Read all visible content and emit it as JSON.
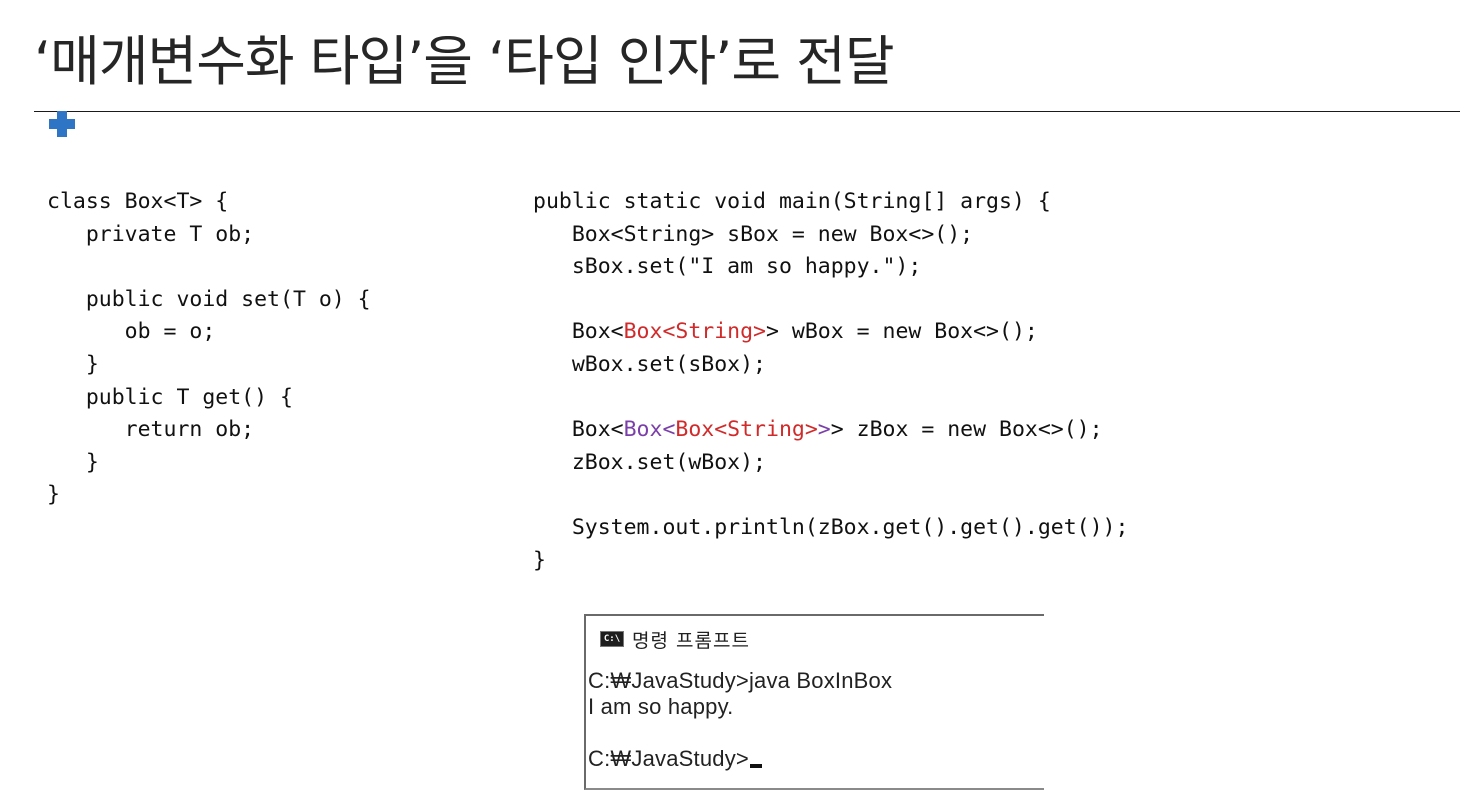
{
  "slide": {
    "title": "‘매개변수화 타입’을 ‘타입 인자’로 전달"
  },
  "code_left": {
    "lines": [
      [
        {
          "t": "class Box<T> {"
        }
      ],
      [
        {
          "t": "   private T ob;"
        }
      ],
      [
        {
          "t": ""
        }
      ],
      [
        {
          "t": "   public void set(T o) {"
        }
      ],
      [
        {
          "t": "      ob = o;"
        }
      ],
      [
        {
          "t": "   }"
        }
      ],
      [
        {
          "t": "   public T get() {"
        }
      ],
      [
        {
          "t": "      return ob;"
        }
      ],
      [
        {
          "t": "   }"
        }
      ],
      [
        {
          "t": "}"
        }
      ]
    ]
  },
  "code_right": {
    "lines": [
      [
        {
          "t": "public static void main(String[] args) {"
        }
      ],
      [
        {
          "t": "   Box<String> sBox = new Box<>();"
        }
      ],
      [
        {
          "t": "   sBox.set(\"I am so happy.\");"
        }
      ],
      [
        {
          "t": ""
        }
      ],
      [
        {
          "t": "   Box<"
        },
        {
          "t": "Box<String>",
          "c": "red"
        },
        {
          "t": "> wBox = new Box<>();"
        }
      ],
      [
        {
          "t": "   wBox.set(sBox);"
        }
      ],
      [
        {
          "t": ""
        }
      ],
      [
        {
          "t": "   Box<"
        },
        {
          "t": "Box<",
          "c": "purple"
        },
        {
          "t": "Box<String>",
          "c": "red"
        },
        {
          "t": ">",
          "c": "purple"
        },
        {
          "t": "> zBox = new Box<>();"
        }
      ],
      [
        {
          "t": "   zBox.set(wBox);"
        }
      ],
      [
        {
          "t": ""
        }
      ],
      [
        {
          "t": "   System.out.println(zBox.get().get().get());"
        }
      ],
      [
        {
          "t": "}"
        }
      ]
    ]
  },
  "console": {
    "icon_text": "C:\\",
    "title": "명령 프롬프트",
    "lines": [
      "C:₩JavaStudy>java BoxInBox",
      "I am so happy.",
      "",
      "C:₩JavaStudy>"
    ]
  },
  "colors": {
    "accent_blue": "#2e75c5",
    "type_red": "#d12a2a",
    "type_purple": "#7a3fa8"
  }
}
